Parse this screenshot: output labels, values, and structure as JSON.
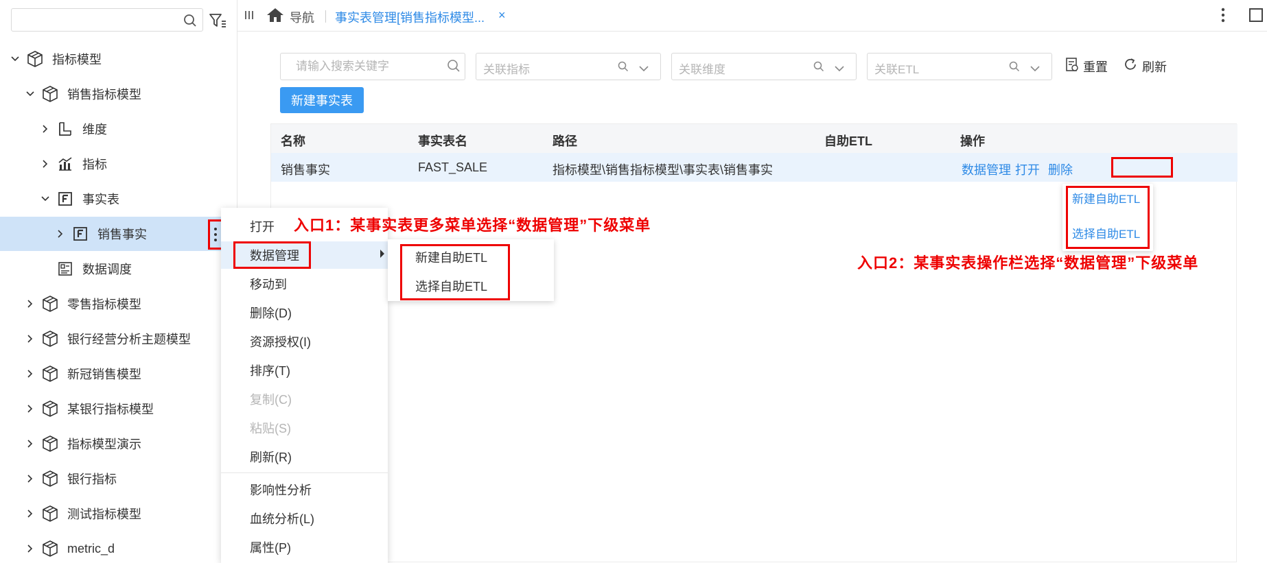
{
  "sidebar": {
    "search_placeholder": "",
    "tree": [
      {
        "label": "指标模型",
        "expanded": true
      },
      {
        "label": "销售指标模型",
        "expanded": true
      },
      {
        "label": "维度"
      },
      {
        "label": "指标"
      },
      {
        "label": "事实表",
        "expanded": true
      },
      {
        "label": "销售事实",
        "selected": true
      },
      {
        "label": "数据调度"
      },
      {
        "label": "零售指标模型"
      },
      {
        "label": "银行经营分析主题模型"
      },
      {
        "label": "新冠销售模型"
      },
      {
        "label": "某银行指标模型"
      },
      {
        "label": "指标模型演示"
      },
      {
        "label": "银行指标"
      },
      {
        "label": "测试指标模型"
      },
      {
        "label": "metric_d"
      }
    ]
  },
  "topbar": {
    "nav_label": "导航",
    "tab_label": "事实表管理[销售指标模型...",
    "close_glyph": "×"
  },
  "filters": {
    "search_placeholder": "请输入搜索关键字",
    "metric_placeholder": "关联指标",
    "dimension_placeholder": "关联维度",
    "etl_placeholder": "关联ETL",
    "reset_label": "重置",
    "refresh_label": "刷新",
    "new_button": "新建事实表"
  },
  "table": {
    "columns": [
      "名称",
      "事实表名",
      "路径",
      "自助ETL",
      "操作"
    ],
    "rows": [
      {
        "name": "销售事实",
        "table_name": "FAST_SALE",
        "path": "指标模型\\销售指标模型\\事实表\\销售事实",
        "etl": "",
        "ops": [
          "数据管理",
          "打开",
          "删除"
        ]
      }
    ]
  },
  "op_dropdown": {
    "items": [
      "新建自助ETL",
      "选择自助ETL"
    ]
  },
  "context_menu": {
    "items": [
      {
        "label": "打开"
      },
      {
        "label": "数据管理",
        "active": true,
        "has_submenu": true
      },
      {
        "label": "移动到"
      },
      {
        "label": "删除(D)"
      },
      {
        "label": "资源授权(I)"
      },
      {
        "label": "排序(T)"
      },
      {
        "label": "复制(C)",
        "disabled": true
      },
      {
        "label": "粘贴(S)",
        "disabled": true
      },
      {
        "label": "刷新(R)"
      },
      {
        "label": "影响性分析"
      },
      {
        "label": "血统分析(L)"
      },
      {
        "label": "属性(P)"
      }
    ],
    "submenu": [
      "新建自助ETL",
      "选择自助ETL"
    ]
  },
  "annotations": {
    "entry1": "入口1：某事实表更多菜单选择“数据管理”下级菜单",
    "entry2": "入口2：某事实表操作栏选择“数据管理”下级菜单"
  },
  "colors": {
    "accent": "#2e8ae6",
    "primary_button": "#3a9af2",
    "highlight_red": "#ee0000",
    "selected_row": "#cfe3f8"
  }
}
